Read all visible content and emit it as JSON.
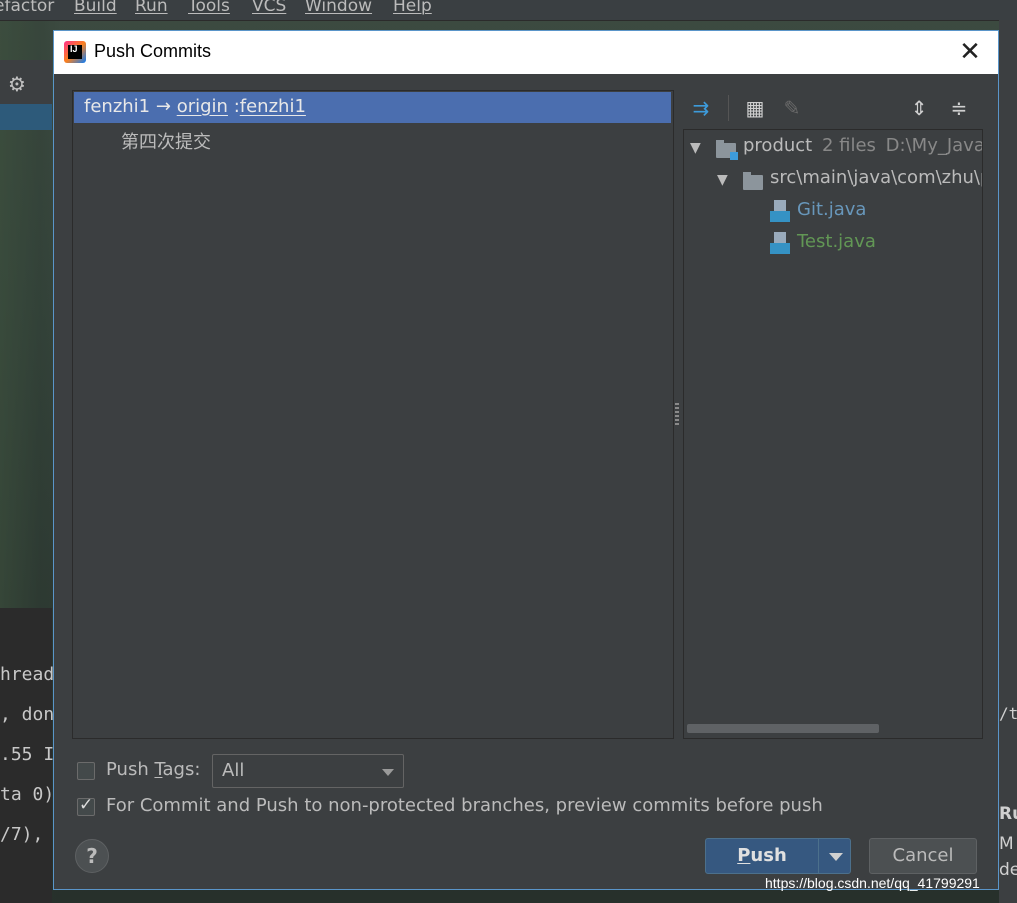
{
  "background": {
    "menu": [
      "efactor",
      "Build",
      "Run",
      "Tools",
      "VCS",
      "Window",
      "Help"
    ],
    "console_lines": [
      "hread",
      ", don",
      ".55 I",
      "ta 0)",
      "/7),"
    ],
    "right_side": [
      "Ru",
      "M",
      "de"
    ],
    "url_fragment": "/t"
  },
  "watermark": "https://blog.csdn.net/qq_41799291",
  "dialog": {
    "title": "Push Commits",
    "app_icon_text": "IJ",
    "close_glyph": "✕",
    "commits": {
      "branch_local": "fenzhi1",
      "arrow": "→",
      "remote": "origin",
      "separator": ":",
      "branch_remote": "fenzhi1",
      "items": [
        {
          "message": "第四次提交"
        }
      ]
    },
    "changes": {
      "module": {
        "name": "product",
        "count": "2 files",
        "path": "D:\\My_Java\\"
      },
      "folder": {
        "name": "src\\main\\java\\com\\zhu\\p"
      },
      "files": [
        {
          "name": "Git.java",
          "color": "#6897bb"
        },
        {
          "name": "Test.java",
          "color": "#629755"
        }
      ]
    },
    "options": {
      "push_tags_label_pre": "Push ",
      "push_tags_label_mnemonic": "T",
      "push_tags_label_post": "ags:",
      "push_tags_checked": false,
      "tags_value": "All",
      "preview_label": "For Commit and Push to non-protected branches, preview commits before push",
      "preview_checked": true
    },
    "buttons": {
      "help": "?",
      "push_mnemonic": "P",
      "push_rest": "ush",
      "cancel": "Cancel"
    }
  }
}
